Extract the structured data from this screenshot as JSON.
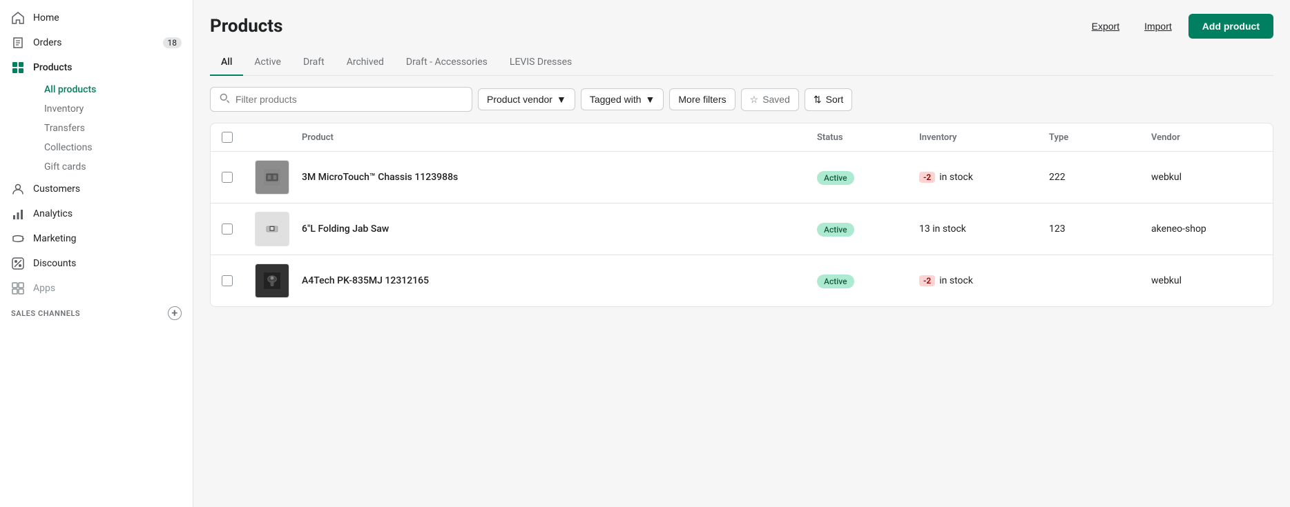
{
  "sidebar": {
    "nav_items": [
      {
        "id": "home",
        "label": "Home",
        "icon": "home"
      },
      {
        "id": "orders",
        "label": "Orders",
        "icon": "orders",
        "badge": "18"
      },
      {
        "id": "products",
        "label": "Products",
        "icon": "products",
        "active_parent": true
      },
      {
        "id": "customers",
        "label": "Customers",
        "icon": "customers"
      },
      {
        "id": "analytics",
        "label": "Analytics",
        "icon": "analytics"
      },
      {
        "id": "marketing",
        "label": "Marketing",
        "icon": "marketing"
      },
      {
        "id": "discounts",
        "label": "Discounts",
        "icon": "discounts"
      },
      {
        "id": "apps",
        "label": "Apps",
        "icon": "apps"
      }
    ],
    "products_sub": [
      {
        "id": "all-products",
        "label": "All products",
        "active": true
      },
      {
        "id": "inventory",
        "label": "Inventory"
      },
      {
        "id": "transfers",
        "label": "Transfers"
      },
      {
        "id": "collections",
        "label": "Collections"
      },
      {
        "id": "gift-cards",
        "label": "Gift cards"
      }
    ],
    "sales_channels_label": "SALES CHANNELS"
  },
  "header": {
    "title": "Products",
    "export_label": "Export",
    "import_label": "Import",
    "add_product_label": "Add product"
  },
  "tabs": [
    {
      "id": "all",
      "label": "All",
      "active": true
    },
    {
      "id": "active",
      "label": "Active"
    },
    {
      "id": "draft",
      "label": "Draft"
    },
    {
      "id": "archived",
      "label": "Archived"
    },
    {
      "id": "draft-accessories",
      "label": "Draft - Accessories"
    },
    {
      "id": "levis-dresses",
      "label": "LEVIS Dresses"
    }
  ],
  "filters": {
    "search_placeholder": "Filter products",
    "product_vendor_label": "Product vendor",
    "tagged_with_label": "Tagged with",
    "more_filters_label": "More filters",
    "saved_label": "Saved",
    "sort_label": "Sort"
  },
  "table": {
    "columns": [
      "",
      "",
      "Product",
      "Status",
      "Inventory",
      "Type",
      "Vendor"
    ],
    "rows": [
      {
        "id": "row-1",
        "name": "3M MicroTouch™ Chassis 1123988s",
        "status": "Active",
        "inventory_badge": "-2",
        "inventory_text": "in stock",
        "type": "222",
        "vendor": "webkul",
        "img_type": "3m"
      },
      {
        "id": "row-2",
        "name": "6\"L Folding Jab Saw",
        "status": "Active",
        "inventory_text": "13 in stock",
        "inventory_badge": null,
        "type": "123",
        "vendor": "akeneo-shop",
        "img_type": "saw"
      },
      {
        "id": "row-3",
        "name": "A4Tech PK-835MJ 12312165",
        "status": "Active",
        "inventory_badge": "-2",
        "inventory_text": "in stock",
        "type": "",
        "vendor": "webkul",
        "img_type": "a4tech"
      }
    ]
  }
}
